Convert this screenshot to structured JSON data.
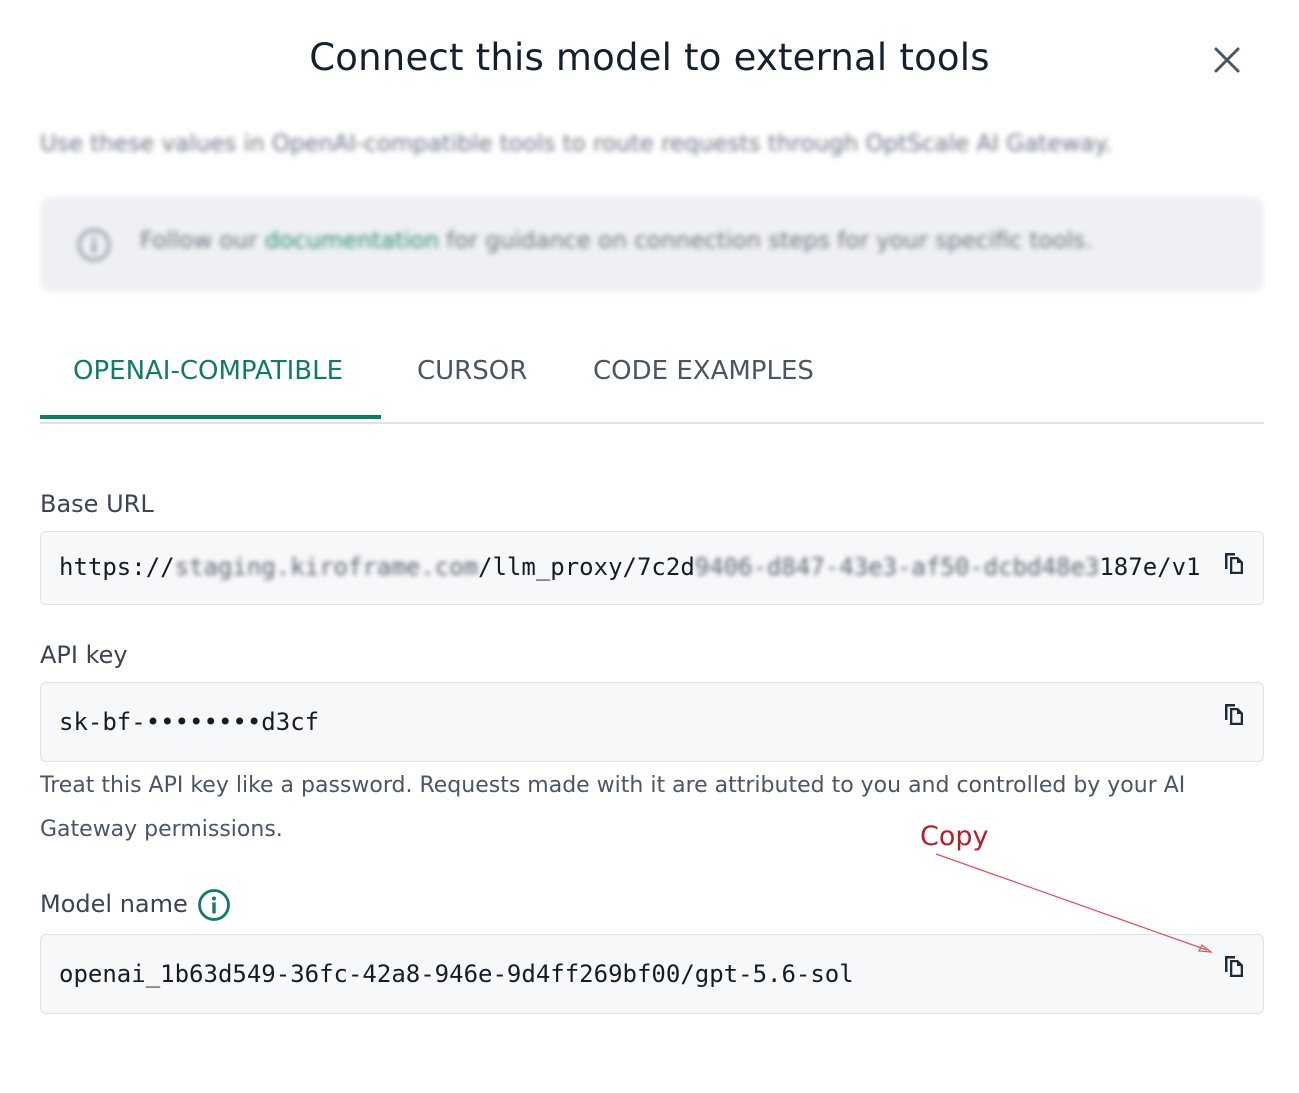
{
  "dialog": {
    "title": "Connect this model to external tools",
    "subtitle": "Use these values in OpenAI-compatible tools to route requests through OptScale AI Gateway.",
    "info": {
      "prefix": "Follow our ",
      "link": "documentation",
      "suffix": " for guidance on connection steps for your specific tools."
    },
    "tabs": [
      "OPENAI-COMPATIBLE",
      "CURSOR",
      "CODE EXAMPLES"
    ],
    "active_tab": "OPENAI-COMPATIBLE"
  },
  "fields": {
    "base_url": {
      "label": "Base URL",
      "value_prefix": "https://",
      "value_host": "staging.kiroframe.com",
      "value_path": "/llm_proxy/7c2d",
      "value_hidden": "9406-d847-43e3-af50-dcbd48e3",
      "value_suffix": "187e/v1"
    },
    "api_key": {
      "label": "API key",
      "value": "sk-bf-••••••••d3cf",
      "hint": "Treat this API key like a password. Requests made with it are attributed to you and controlled by your AI Gateway permissions."
    },
    "model_name": {
      "label": "Model name",
      "value": "openai_1b63d549-36fc-42a8-946e-9d4ff269bf00/gpt-5.6-sol"
    }
  },
  "annotation": {
    "label": "Copy"
  },
  "colors": {
    "accent": "#117c66",
    "annotation": "#b3202a",
    "field_bg": "#f7f8fa",
    "banner_bg": "#eef0f3"
  },
  "icons": {
    "close": "close-icon",
    "info": "info-icon",
    "copy": "copy-icon"
  }
}
